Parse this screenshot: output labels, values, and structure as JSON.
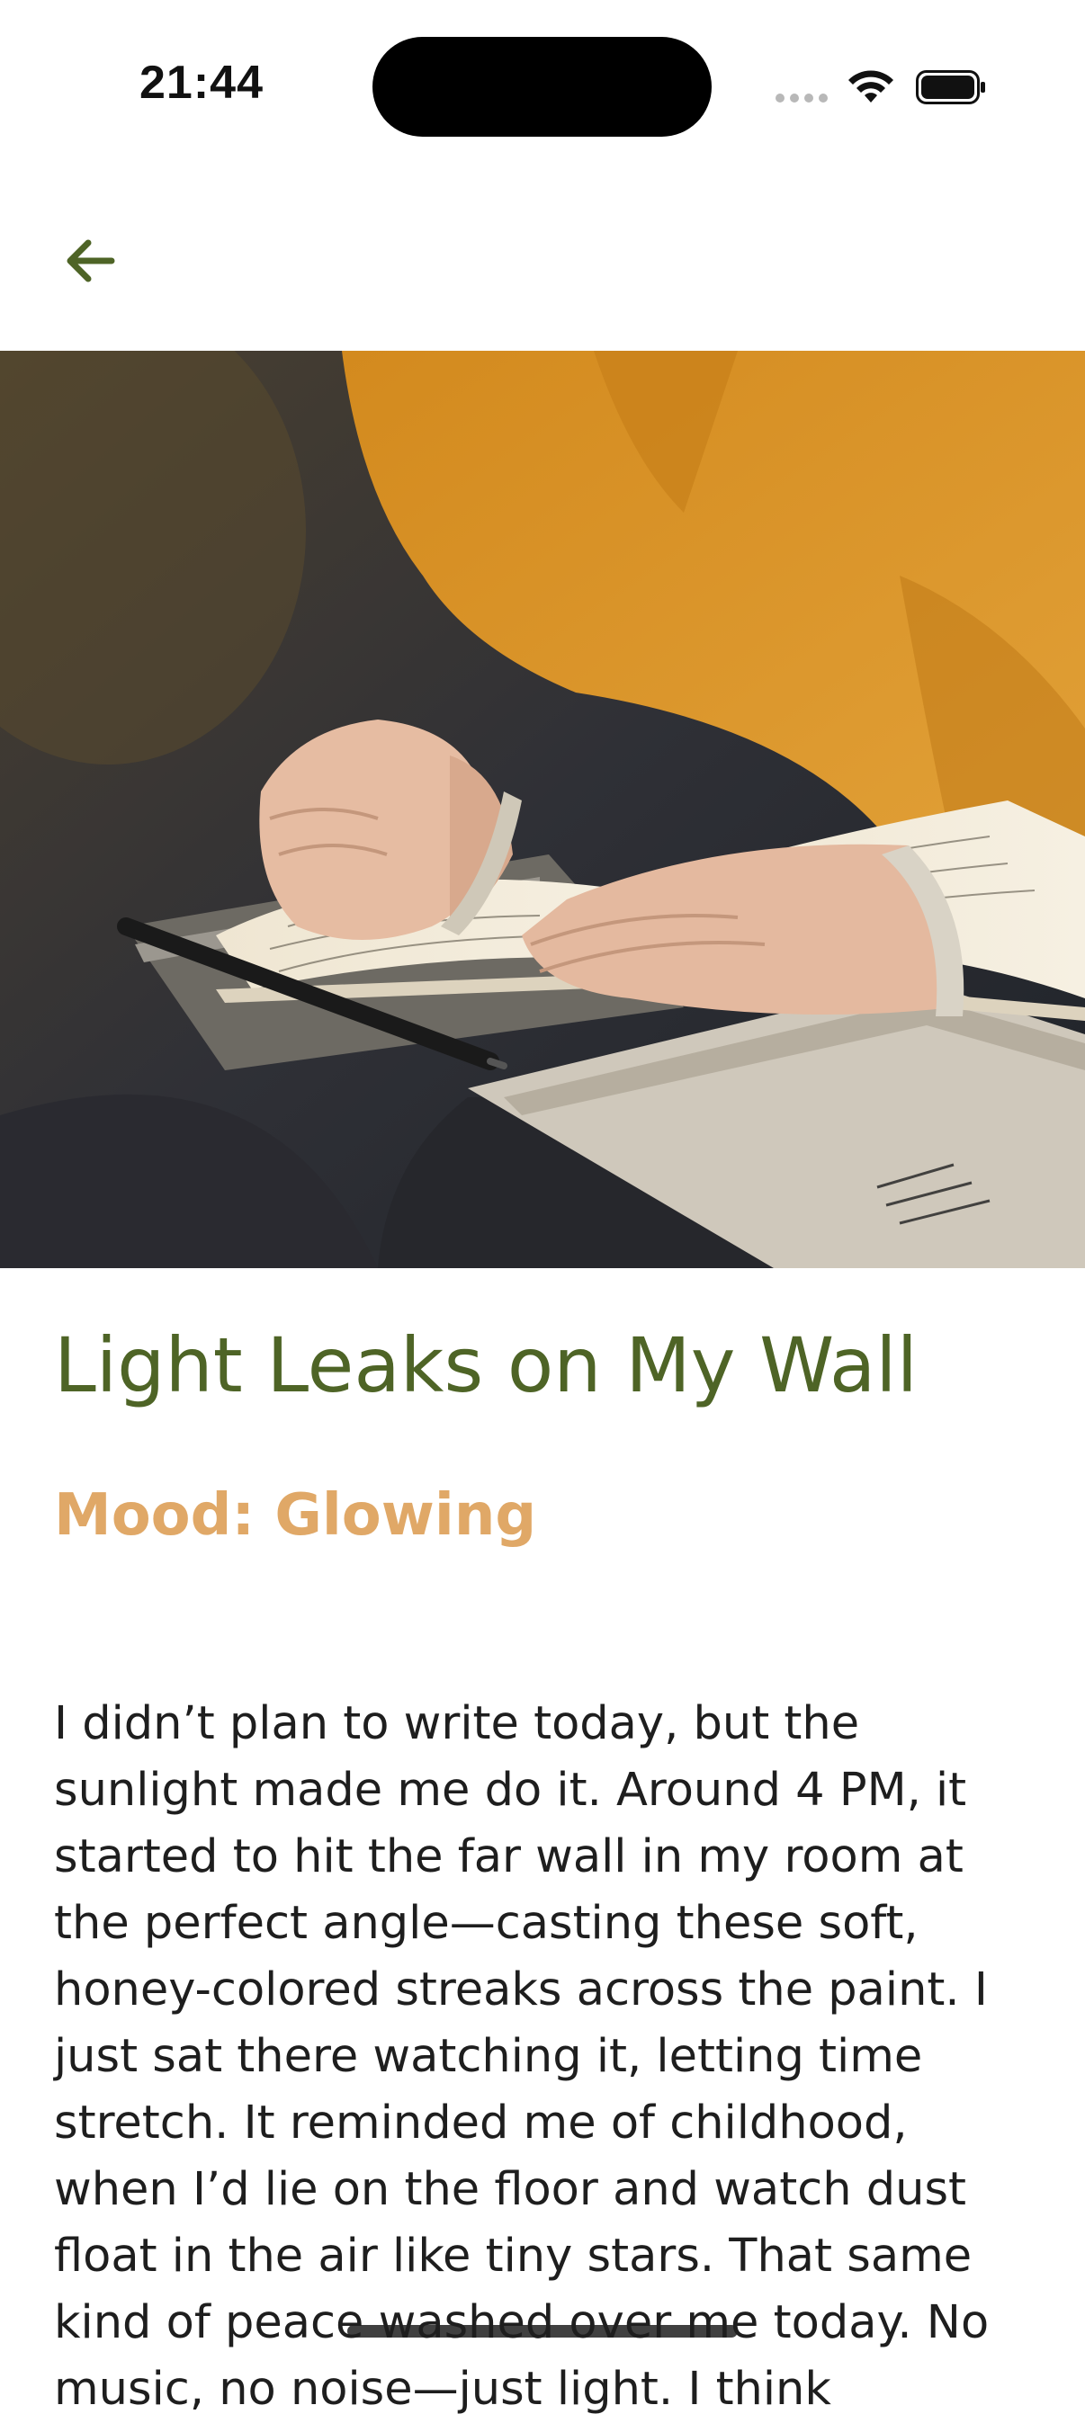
{
  "status_bar": {
    "time": "21:44",
    "icons": [
      "signal-dots-icon",
      "wifi-icon",
      "battery-icon"
    ]
  },
  "nav": {
    "back_icon": "arrow-left-icon"
  },
  "hero_image": {
    "description_icon": "journal-writing-photo"
  },
  "entry": {
    "title": "Light Leaks on My Wall",
    "mood": "Mood: Glowing",
    "body": "I didn’t plan to write today, but the sunlight made me do it. Around 4 PM, it started to hit the far wall in my room at the perfect angle—casting these soft, honey-colored streaks across the paint. I just sat there watching it, letting time stretch. It reminded me of childhood, when I’d lie on the floor and watch dust float in the air like tiny stars. That same kind of peace washed over me today. No music, no noise—just light. I think"
  },
  "colors": {
    "accent": "#4e6426",
    "mood": "#e0a867",
    "text": "#1e1e1e"
  }
}
